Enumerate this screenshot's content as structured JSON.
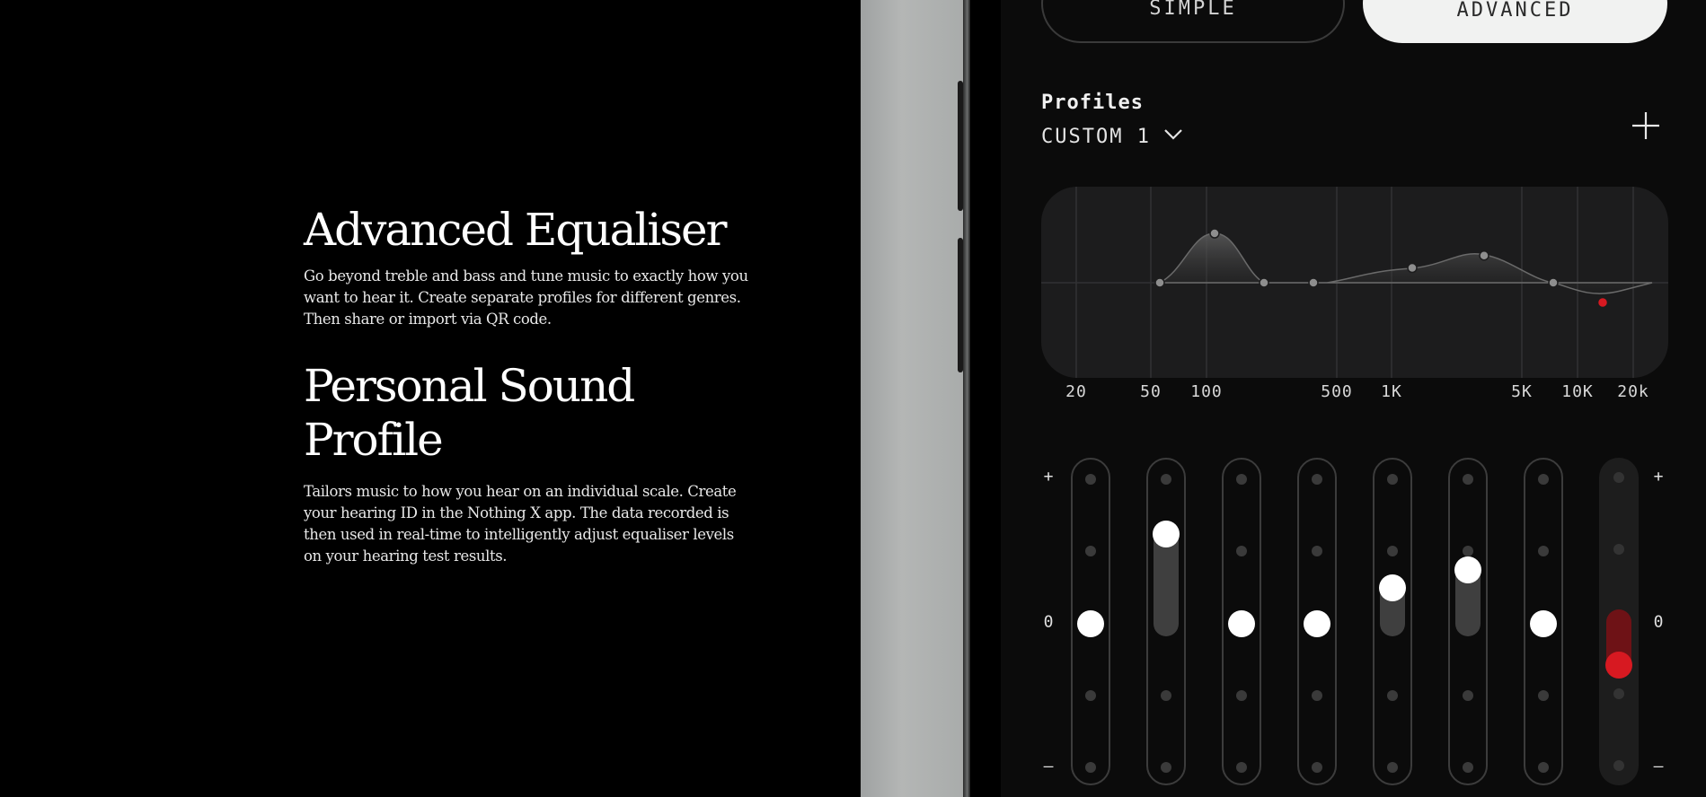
{
  "features": [
    {
      "heading": "Advanced Equaliser",
      "body": "Go beyond treble and bass and tune music to exactly how you want to hear it. Create separate profiles for different genres. Then share or import via QR code."
    },
    {
      "heading": "Personal Sound Profile",
      "body": "Tailors music to how you hear on an individual scale. Create your hearing ID in the Nothing X app. The data recorded is then used in real-time to intelligently adjust equaliser levels on your hearing test results."
    }
  ],
  "eq_app": {
    "modes": [
      {
        "label": "SIMPLE",
        "selected": false
      },
      {
        "label": "ADVANCED",
        "selected": true
      }
    ],
    "profiles_label": "Profiles",
    "current_profile": "CUSTOM 1",
    "frequency_labels": [
      "20",
      "50",
      "100",
      "500",
      "1K",
      "5K",
      "10K",
      "20k"
    ],
    "scale": {
      "plus": "+",
      "zero": "0",
      "minus": "–"
    },
    "bands": [
      {
        "level": 0,
        "color": "#ffffff"
      },
      {
        "level": 1.25,
        "color": "#ffffff"
      },
      {
        "level": 0,
        "color": "#ffffff"
      },
      {
        "level": 0,
        "color": "#ffffff"
      },
      {
        "level": 0.5,
        "color": "#ffffff"
      },
      {
        "level": 0.75,
        "color": "#ffffff"
      },
      {
        "level": 0,
        "color": "#ffffff"
      },
      {
        "level": -0.6,
        "color": "#d71921",
        "active": true
      }
    ],
    "curve_points": [
      {
        "freq_label": "50",
        "level": 0
      },
      {
        "freq_label": "100",
        "level": 1.0
      },
      {
        "freq_label": "",
        "level": 0
      },
      {
        "freq_label": "500",
        "level": 0
      },
      {
        "freq_label": "1K",
        "level": 0.3
      },
      {
        "freq_label": "",
        "level": 0.55
      },
      {
        "freq_label": "",
        "level": 0
      },
      {
        "freq_label": "",
        "level": -0.4
      }
    ],
    "colors": {
      "accent_red": "#d71921",
      "screen_bg": "#0b0b0b",
      "panel_bg": "#1c1c1c"
    }
  }
}
